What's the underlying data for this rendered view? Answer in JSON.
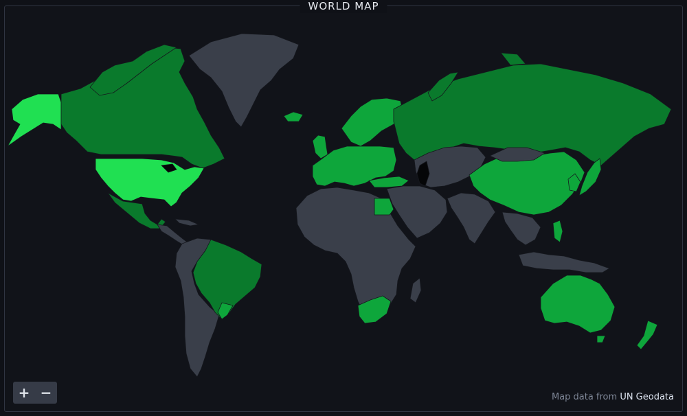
{
  "panel": {
    "title": "WORLD MAP"
  },
  "controls": {
    "zoom_in_label": "+",
    "zoom_out_label": "−",
    "zoom_in_icon": "plus-icon",
    "zoom_out_icon": "minus-icon"
  },
  "attribution": {
    "prefix": "Map data from ",
    "link_text": "UN Geodata"
  },
  "colors": {
    "background": "#111319",
    "land_default": "#3a3f4a",
    "green_bright": "#20e052",
    "green_mid": "#0ea63b",
    "green_dark": "#0a7a2c",
    "water_lake": "#050608"
  },
  "countries": [
    {
      "id": "greenland",
      "shade": "land_default"
    },
    {
      "id": "canada",
      "shade": "green_dark"
    },
    {
      "id": "alaska",
      "shade": "green_bright"
    },
    {
      "id": "usa",
      "shade": "green_bright"
    },
    {
      "id": "mexico",
      "shade": "green_dark"
    },
    {
      "id": "central-america",
      "shade": "land_default"
    },
    {
      "id": "south-america-west",
      "shade": "land_default"
    },
    {
      "id": "brazil",
      "shade": "green_dark"
    },
    {
      "id": "uruguay",
      "shade": "green_mid"
    },
    {
      "id": "iceland",
      "shade": "green_mid"
    },
    {
      "id": "uk",
      "shade": "green_mid"
    },
    {
      "id": "scandinavia",
      "shade": "green_mid"
    },
    {
      "id": "europe",
      "shade": "green_mid"
    },
    {
      "id": "russia",
      "shade": "green_dark"
    },
    {
      "id": "central-asia",
      "shade": "land_default"
    },
    {
      "id": "china",
      "shade": "green_mid"
    },
    {
      "id": "japan",
      "shade": "green_mid"
    },
    {
      "id": "korea",
      "shade": "green_mid"
    },
    {
      "id": "middle-east",
      "shade": "land_default"
    },
    {
      "id": "india",
      "shade": "land_default"
    },
    {
      "id": "southeast-asia",
      "shade": "land_default"
    },
    {
      "id": "philippines",
      "shade": "green_mid"
    },
    {
      "id": "indonesia",
      "shade": "land_default"
    },
    {
      "id": "africa",
      "shade": "land_default"
    },
    {
      "id": "egypt",
      "shade": "green_mid"
    },
    {
      "id": "south-africa",
      "shade": "green_mid"
    },
    {
      "id": "madagascar",
      "shade": "land_default"
    },
    {
      "id": "australia",
      "shade": "green_mid"
    },
    {
      "id": "new-zealand",
      "shade": "green_mid"
    },
    {
      "id": "caspian-sea",
      "shade": "water_lake"
    }
  ]
}
